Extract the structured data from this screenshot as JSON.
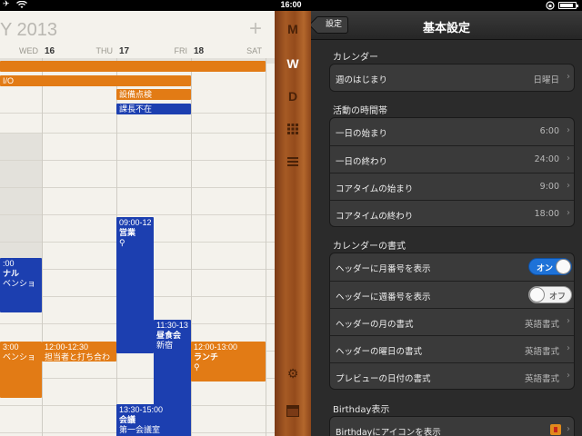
{
  "status_bar": {
    "time": "16:00",
    "airplane_icon": "✈",
    "wifi_icon": "wifi-icon",
    "lock_icon": "lock-icon",
    "battery_level": 0.9
  },
  "calendar": {
    "month_title": "Y 2013",
    "add_label": "+",
    "days": [
      {
        "num": "",
        "name": "WED"
      },
      {
        "num": "16",
        "name": "THU"
      },
      {
        "num": "17",
        "name": "FRI"
      },
      {
        "num": "18",
        "name": "SAT"
      }
    ],
    "events": {
      "io": "I/O",
      "setsubi": "設備点検",
      "kacho": "課長不在",
      "eigyo_time": "09:00-12",
      "eigyo_title": "営業",
      "left1_time": ":00",
      "left1_title": "ナル",
      "left1_sub": "ベンショ",
      "left2_time": "3:00",
      "left2_sub": "ベンショ",
      "tanto_time": "12:00-12:30",
      "tanto_title": "担当者と打ち合わ",
      "chushoku_time": "11:30-13",
      "chushoku_title": "昼食会",
      "chushoku_place": "新宿",
      "lunch_time": "12:00-13:00",
      "lunch_title": "ランチ",
      "kaigi_time": "13:30-15:00",
      "kaigi_title": "会議",
      "kaigi_place": "第一会議室"
    }
  },
  "sidebar": {
    "tabs": [
      "M",
      "W",
      "D"
    ],
    "active_tab": "W"
  },
  "settings": {
    "back_label": "設定",
    "title": "基本設定",
    "sections": {
      "calendar": {
        "header": "カレンダー",
        "week_start_label": "週のはじまり",
        "week_start_value": "日曜日"
      },
      "active_hours": {
        "header": "活動の時間帯",
        "day_start_label": "一日の始まり",
        "day_start_value": "6:00",
        "day_end_label": "一日の終わり",
        "day_end_value": "24:00",
        "core_start_label": "コアタイムの始まり",
        "core_start_value": "9:00",
        "core_end_label": "コアタイムの終わり",
        "core_end_value": "18:00"
      },
      "format": {
        "header": "カレンダーの書式",
        "month_num_label": "ヘッダーに月番号を表示",
        "month_num_state": "オン",
        "week_num_label": "ヘッダーに週番号を表示",
        "week_num_state": "オフ",
        "month_format_label": "ヘッダーの月の書式",
        "month_format_value": "英語書式",
        "weekday_format_label": "ヘッダーの曜日の書式",
        "weekday_format_value": "英語書式",
        "preview_date_label": "プレビューの日付の書式",
        "preview_date_value": "英語書式"
      },
      "birthday": {
        "header": "Birthday表示",
        "icon_label": "Birthdayにアイコンを表示"
      }
    }
  }
}
